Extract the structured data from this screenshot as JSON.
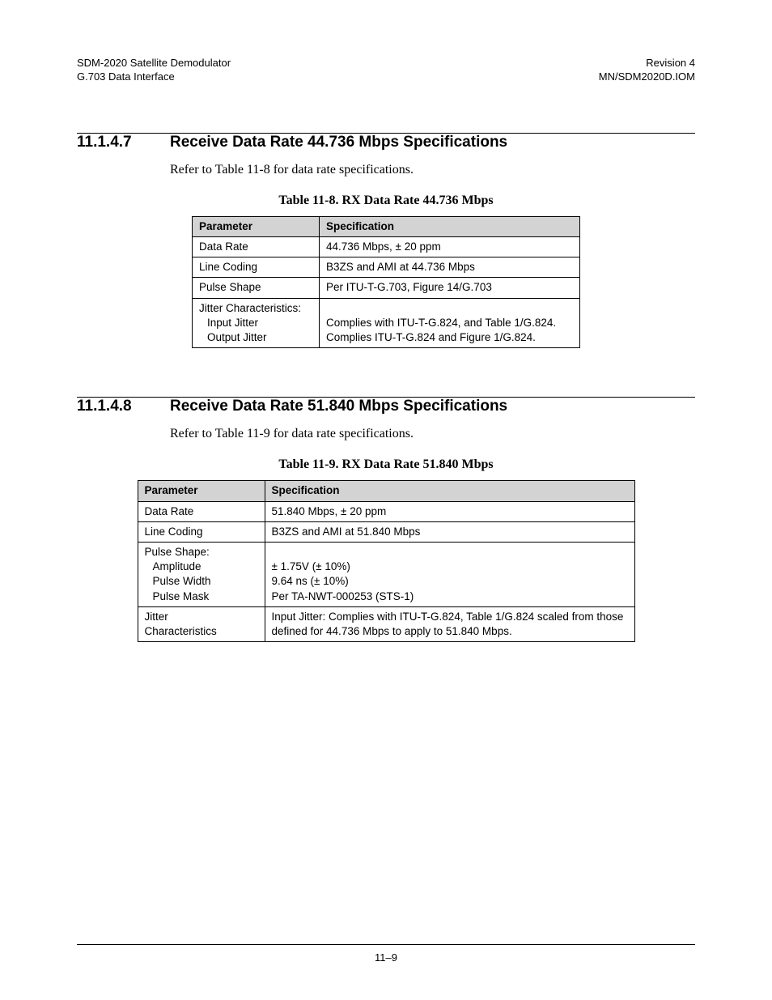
{
  "header": {
    "left_line1": "SDM-2020 Satellite Demodulator",
    "left_line2": "G.703 Data Interface",
    "right_line1": "Revision 4",
    "right_line2": "MN/SDM2020D.IOM"
  },
  "section1": {
    "number": "11.1.4.7",
    "title": "Receive Data Rate 44.736 Mbps Specifications",
    "intro": "Refer to Table 11-8 for data rate specifications.",
    "table_caption": "Table 11-8. RX Data Rate 44.736 Mbps",
    "th_param": "Parameter",
    "th_spec": "Specification",
    "rows": {
      "r0p": "Data Rate",
      "r0s": "44.736 Mbps, ± 20 ppm",
      "r1p": "Line Coding",
      "r1s": "B3ZS and AMI at 44.736 Mbps",
      "r2p": "Pulse Shape",
      "r2s": "Per ITU-T-G.703, Figure 14/G.703",
      "r3p_l1": "Jitter Characteristics:",
      "r3p_l2": "Input Jitter",
      "r3p_l3": "Output Jitter",
      "r3s_l1": "",
      "r3s_l2": "Complies with ITU-T-G.824, and Table 1/G.824.",
      "r3s_l3": "Complies ITU-T-G.824 and Figure 1/G.824."
    }
  },
  "section2": {
    "number": "11.1.4.8",
    "title": "Receive Data Rate 51.840 Mbps Specifications",
    "intro": "Refer to Table 11-9 for data rate specifications.",
    "table_caption": "Table 11-9. RX Data Rate 51.840 Mbps",
    "th_param": "Parameter",
    "th_spec": "Specification",
    "rows": {
      "r0p": "Data Rate",
      "r0s": "51.840 Mbps, ± 20 ppm",
      "r1p": "Line Coding",
      "r1s": "B3ZS and AMI at 51.840 Mbps",
      "r2p_l1": "Pulse Shape:",
      "r2p_l2": "Amplitude",
      "r2p_l3": "Pulse Width",
      "r2p_l4": "Pulse Mask",
      "r2s_l1": "",
      "r2s_l2": "± 1.75V (± 10%)",
      "r2s_l3": "9.64 ns (± 10%)",
      "r2s_l4": "Per TA-NWT-000253 (STS-1)",
      "r3p_l1": "Jitter",
      "r3p_l2": "Characteristics",
      "r3s": "Input Jitter: Complies with ITU-T-G.824, Table 1/G.824 scaled from those defined for 44.736 Mbps to apply to 51.840 Mbps."
    }
  },
  "footer": {
    "page": "11–9"
  }
}
